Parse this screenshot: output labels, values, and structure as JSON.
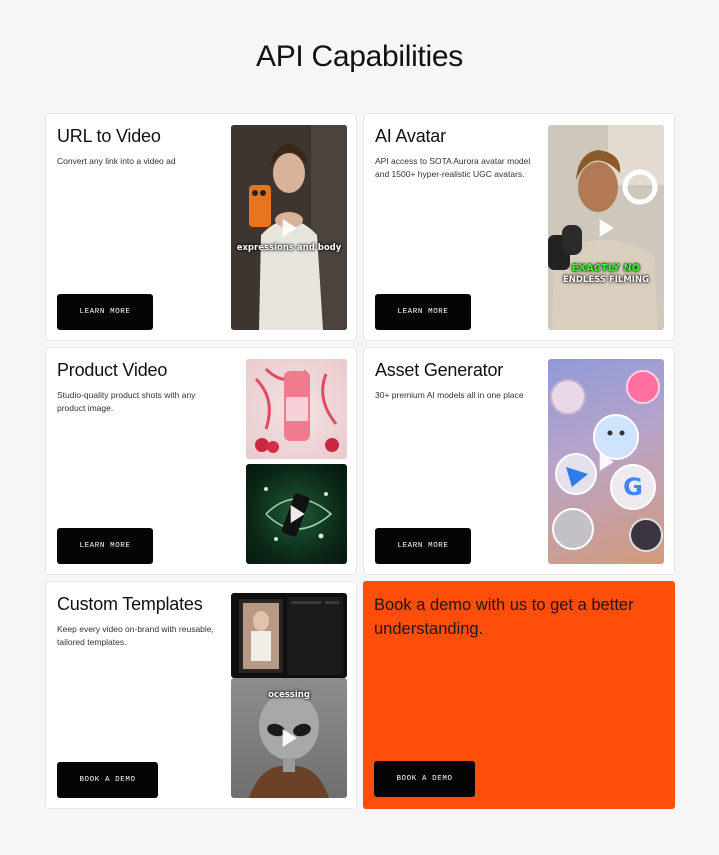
{
  "page": {
    "title": "API Capabilities"
  },
  "cards": [
    {
      "title": "URL to Video",
      "description": "Convert any link into a video ad",
      "button": "LEARN MORE",
      "media_caption": "expressions and body"
    },
    {
      "title": "AI Avatar",
      "description": "API access to SOTA Aurora avatar model and 1500+ hyper-realistic UGC avatars.",
      "button": "LEARN MORE",
      "media_caption_line1": "EXACTLY NO",
      "media_caption_line2": "ENDLESS FILMING"
    },
    {
      "title": "Product Video",
      "description": "Studio-quality product shots with any product image.",
      "button": "LEARN MORE"
    },
    {
      "title": "Asset Generator",
      "description": "30+ premium AI models all in one place",
      "button": "LEARN MORE"
    },
    {
      "title": "Custom Templates",
      "description": "Keep every video on-brand with reusable, tailored templates.",
      "button": "BOOK A DEMO",
      "media_caption": "ocessing"
    }
  ],
  "cta": {
    "text": "Book a demo with us to get a better understanding.",
    "button": "BOOK A DEMO",
    "background": "#ff4d0a"
  },
  "colors": {
    "accent": "#ff4d0a",
    "button": "#050505",
    "background": "#f6f6f7"
  }
}
